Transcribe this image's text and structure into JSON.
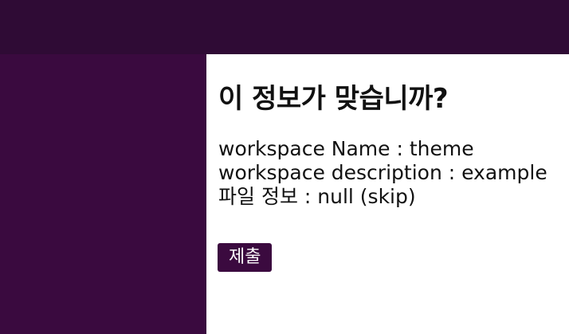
{
  "header": {},
  "confirm": {
    "title": "이 정보가 맞습니까?",
    "rows": [
      "workspace Name : theme",
      "workspace description : example",
      "파일 정보 : null (skip)"
    ],
    "submit_label": "제출"
  },
  "colors": {
    "topbar": "#2f0b35",
    "sidebar": "#3a0a3f",
    "button": "#3b0a3f",
    "content_bg": "#ffffff"
  }
}
